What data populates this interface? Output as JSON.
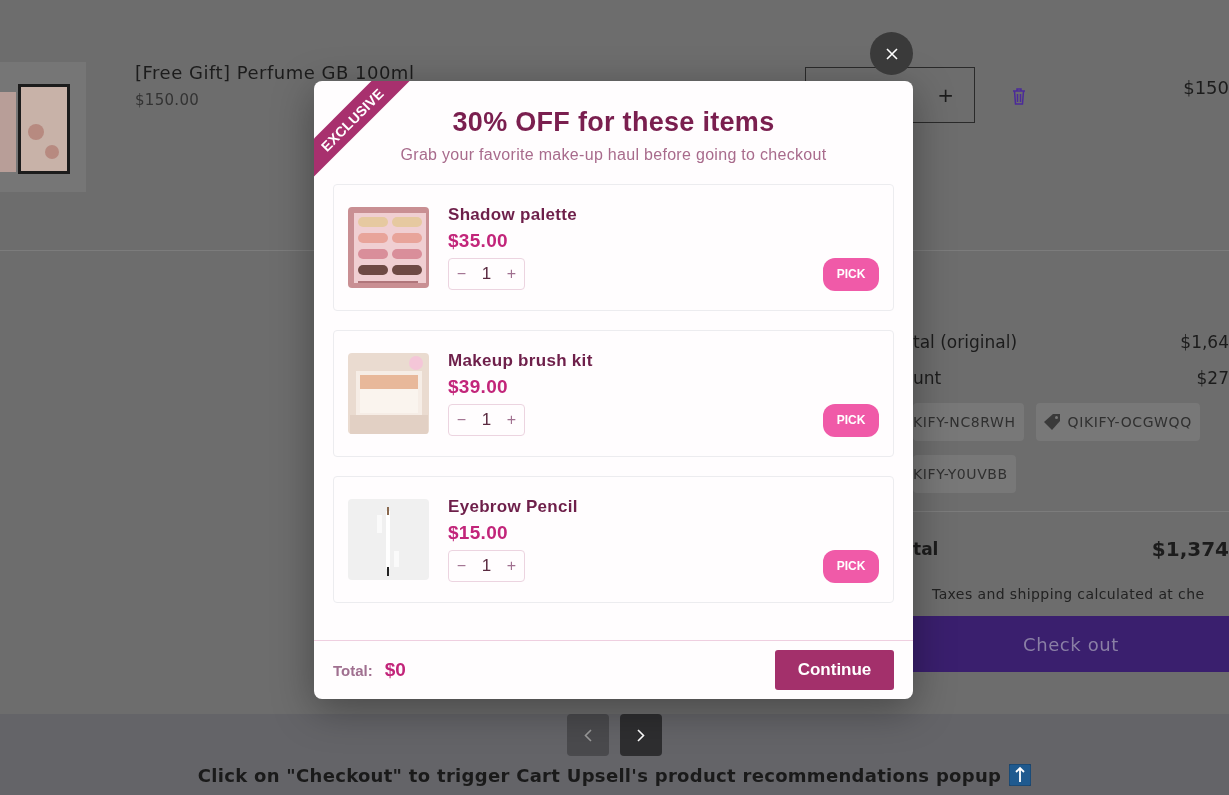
{
  "cart_item": {
    "title": "[Free Gift] Perfume GB 100ml",
    "price": "$150.00",
    "plus": "+",
    "line_total": "$150"
  },
  "summary": {
    "rows": [
      {
        "label": "tal (original)",
        "value": "$1,64"
      },
      {
        "label": "unt",
        "value": "$27"
      }
    ],
    "discount_codes": [
      {
        "code": "KIFY-NC8RWH",
        "tagged": false
      },
      {
        "code": "QIKIFY-OCGWQQ",
        "tagged": true
      },
      {
        "code": "KIFY-Y0UVBB",
        "tagged": false
      }
    ],
    "total_label": "tal",
    "total_value": "$1,374",
    "note": "Taxes and shipping calculated at che",
    "checkout_button": "Check out"
  },
  "pager": {
    "buttons": [
      {
        "kind": "prev",
        "disabled": true
      },
      {
        "kind": "next",
        "disabled": false
      }
    ],
    "caption": "Click on \"Checkout\" to trigger Cart Upsell's product recommendations popup"
  },
  "popup": {
    "ribbon": "EXCLUSIVE",
    "title": "30% OFF for these items",
    "subtitle": "Grab your favorite make-up haul before going to checkout",
    "products": [
      {
        "kind": "palette",
        "name": "Shadow palette",
        "price": "$35.00",
        "minus": "−",
        "quantity": "1",
        "plus": "+",
        "button": "PICK"
      },
      {
        "kind": "brushes",
        "name": "Makeup brush kit",
        "price": "$39.00",
        "minus": "−",
        "quantity": "1",
        "plus": "+",
        "button": "PICK"
      },
      {
        "kind": "pencil",
        "name": "Eyebrow Pencil",
        "price": "$15.00",
        "minus": "−",
        "quantity": "1",
        "plus": "+",
        "button": "PICK"
      }
    ],
    "total_label": "Total:",
    "total_value": "$0",
    "continue_button": "Continue"
  }
}
